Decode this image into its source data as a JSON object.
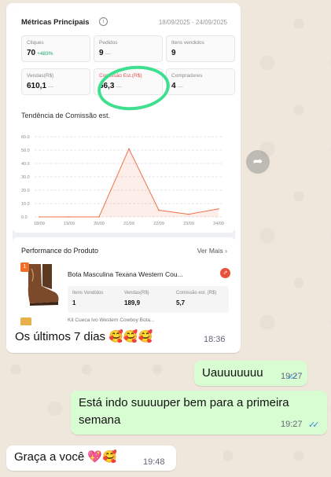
{
  "image_message": {
    "metrics": {
      "title": "Métricas Principais",
      "info_icon": "ⓘ",
      "date_range": "18/09/2025 - 24/09/2025",
      "tiles": [
        {
          "label": "Cliques",
          "value": "70",
          "delta": "+483%"
        },
        {
          "label": "Pedidos",
          "value": "9",
          "dash": "—"
        },
        {
          "label": "Itens vendidos",
          "value": "9",
          "dash": ""
        },
        {
          "label": "Vendas(R$)",
          "value": "610,1",
          "dash": "—"
        },
        {
          "label": "Comissão Est.(R$)",
          "value": "66,3",
          "dash": "—"
        },
        {
          "label": "Compradores",
          "value": "4",
          "dash": "—"
        }
      ]
    },
    "chart_title": "Tendência de Comissão est.",
    "chart_data": {
      "type": "area",
      "categories": [
        "18/09",
        "19/09",
        "20/09",
        "21/09",
        "22/09",
        "23/09",
        "24/09"
      ],
      "values": [
        0,
        0,
        0,
        51,
        5,
        2,
        6
      ],
      "ylim": [
        0,
        60
      ],
      "yticks": [
        "0.0",
        "10.0",
        "20.0",
        "30.0",
        "40.0",
        "50.0",
        "60.0"
      ],
      "color": "#f0704a",
      "grid": true
    },
    "performance": {
      "title": "Performance do Produto",
      "more": "Ver Mais",
      "more_icon": "›",
      "rank_badge": "1",
      "product_name": "Bota Masculina Texana Western Cou...",
      "share_icon": "⇗",
      "stats": [
        {
          "label": "Itens Vendidos",
          "value": "1"
        },
        {
          "label": "Vendas(R$)",
          "value": "189,9"
        },
        {
          "label": "Comissão est. (R$)",
          "value": "5,7"
        }
      ],
      "next_item_name": "Kit Cueca Ivo Western Cowboy Bota..."
    },
    "caption": "Os últimos 7 dias 🥰🥰🥰",
    "time": "18:36"
  },
  "forward_icon": "➦",
  "messages": [
    {
      "text": "Uauuuuuuu",
      "time": "19:27",
      "ticks": "✓✓"
    },
    {
      "text_line1": "Está indo suuuuper bem para a primeira",
      "text_line2": "semana",
      "time": "19:27",
      "ticks": "✓✓"
    },
    {
      "text": "Graça a você 💖🥰",
      "time": "19:48"
    }
  ]
}
